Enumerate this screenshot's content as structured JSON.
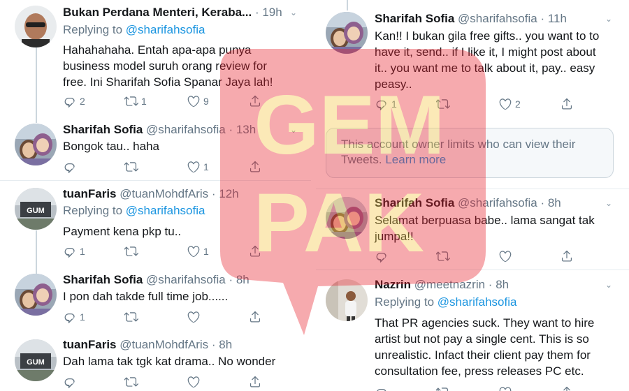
{
  "left": {
    "tweets": [
      {
        "name": "Bukan Perdana Menteri, Keraba...",
        "handle": "",
        "time": "19h",
        "replying_label": "Replying to",
        "replying_to": "@sharifahsofia",
        "lines": [
          "Hahahahaha. Entah apa-apa punya",
          "business model suruh orang review for",
          "free. Ini Sharifah Sofia Spanar Jaya lah!"
        ],
        "reply_count": "2",
        "retweet_count": "1",
        "like_count": "9"
      },
      {
        "name": "Sharifah Sofia",
        "handle": "@sharifahsofia",
        "time": "13h",
        "lines": [
          "Bongok tau.. haha"
        ],
        "reply_count": "",
        "retweet_count": "",
        "like_count": "1"
      },
      {
        "name": "tuanFaris",
        "handle": "@tuanMohdfAris",
        "time": "12h",
        "replying_label": "Replying to",
        "replying_to": "@sharifahsofia",
        "lines": [
          "Payment kena pkp tu.."
        ],
        "reply_count": "1",
        "retweet_count": "",
        "like_count": "1"
      },
      {
        "name": "Sharifah Sofia",
        "handle": "@sharifahsofia",
        "time": "8h",
        "lines": [
          "I pon dah takde full time job......"
        ],
        "reply_count": "1",
        "retweet_count": "",
        "like_count": ""
      },
      {
        "name": "tuanFaris",
        "handle": "@tuanMohdfAris",
        "time": "8h",
        "lines": [
          "Dah lama tak tgk kat drama.. No wonder"
        ],
        "reply_count": "",
        "retweet_count": "",
        "like_count": ""
      }
    ]
  },
  "right": {
    "tweets": [
      {
        "name": "Sharifah Sofia",
        "handle": "@sharifahsofia",
        "time": "11h",
        "lines": [
          "Kan!! I bukan gila free gifts.. you want to to",
          "have it, send.. if I like it, I might post about",
          "it.. you want me to talk about it, pay.. easy",
          "peasy.."
        ],
        "reply_count": "1",
        "retweet_count": "",
        "like_count": "2"
      },
      {
        "name": "Sharifah Sofia",
        "handle": "@sharifahsofia",
        "time": "8h",
        "lines": [
          "Selamat berpuasa babe.. lama sangat tak",
          "jumpa!!"
        ],
        "reply_count": "",
        "retweet_count": "",
        "like_count": ""
      },
      {
        "name": "Nazrin",
        "handle": "@meetnazrin",
        "time": "8h",
        "replying_label": "Replying to",
        "replying_to": "@sharifahsofia",
        "lines": [
          "That PR agencies suck. They want to hire",
          "artist but not pay a single cent. This is so",
          "unrealistic. Infact their client pay them for",
          "consultation fee, press releases PC etc."
        ],
        "reply_count": "",
        "retweet_count": "",
        "like_count": ""
      }
    ],
    "notice": {
      "text": "This account owner limits who can view their Tweets.",
      "link": "Learn more"
    }
  },
  "watermark": {
    "text_top": "GEM",
    "text_bottom": "PAK",
    "color": "#e8212e"
  },
  "colors": {
    "text": "#14171a",
    "muted": "#657786",
    "accent": "#1b95e0",
    "border": "#e6ecf0"
  },
  "icons": [
    "reply-icon",
    "retweet-icon",
    "like-icon",
    "share-icon",
    "chevron-down-icon"
  ]
}
